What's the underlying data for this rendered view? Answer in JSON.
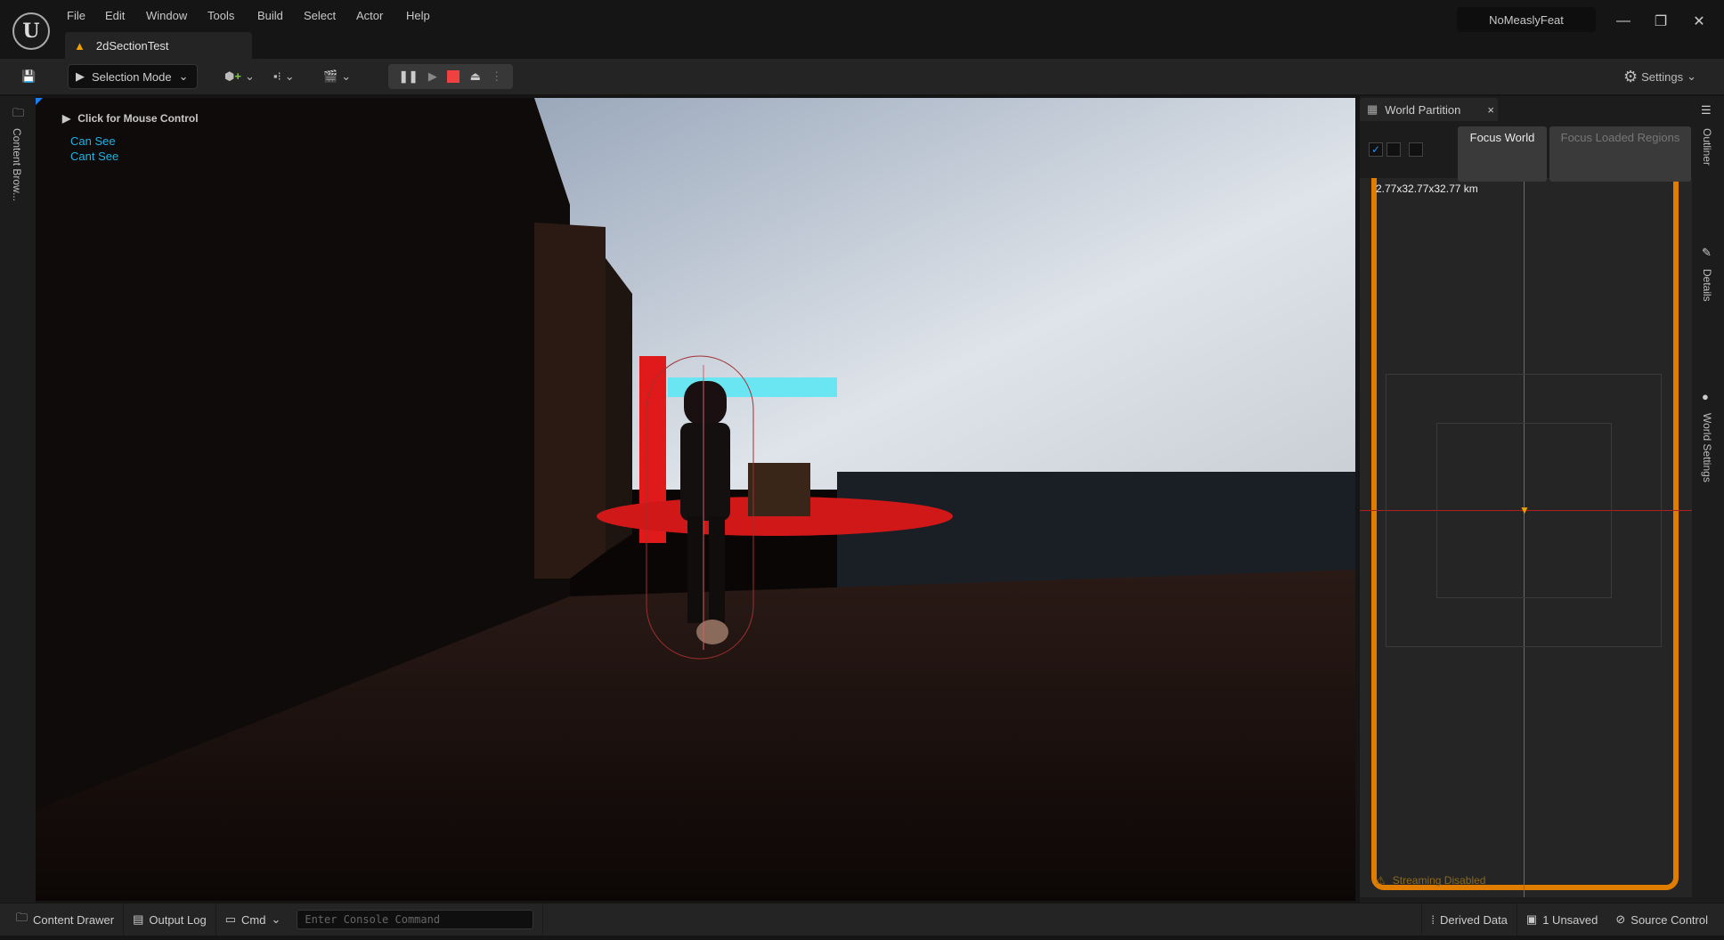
{
  "menu": [
    "File",
    "Edit",
    "Window",
    "Tools",
    "Build",
    "Select",
    "Actor",
    "Help"
  ],
  "document_tab": "2dSectionTest",
  "project_name": "NoMeaslyFeat",
  "toolbar": {
    "selection_mode": "Selection Mode",
    "settings": "Settings"
  },
  "left_sidebar": {
    "content_browser": "Content Brow..."
  },
  "viewport": {
    "mouse_hint": "Click for Mouse Control",
    "debug_lines": [
      "Can See",
      "Cant See"
    ]
  },
  "world_partition": {
    "tab_title": "World Partition",
    "focus_world": "Focus World",
    "focus_loaded_regions": "Focus Loaded Regions",
    "world_size": "2.77x32.77x32.77 km",
    "streaming_status": "Streaming Disabled",
    "accent": "#e07d00"
  },
  "right_sidebar": [
    "Outliner",
    "Details",
    "World Settings"
  ],
  "statusbar": {
    "content_drawer": "Content Drawer",
    "output_log": "Output Log",
    "cmd": "Cmd",
    "console_placeholder": "Enter Console Command",
    "derived_data": "Derived Data",
    "unsaved": "1 Unsaved",
    "source_control": "Source Control"
  }
}
